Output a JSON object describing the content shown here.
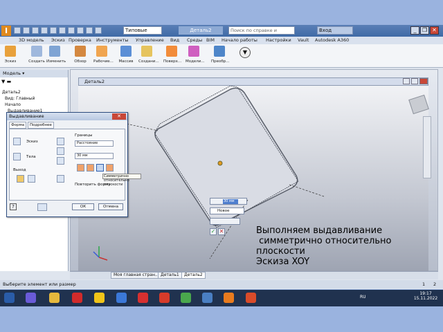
{
  "title_bar": {
    "logo": "I",
    "style_combo": "Типовые",
    "file_name": "Деталь2",
    "help_search": "Поиск по справке и командам",
    "user": "Вход",
    "window_buttons": [
      "_",
      "❐",
      "✕"
    ]
  },
  "menu": [
    "3D модель",
    "Эскиз",
    "Проверка",
    "Инструменты",
    "Управление",
    "Вид",
    "Среды",
    "BIM",
    "Начало работы",
    "Настройки",
    "Vault",
    "Autodesk A360"
  ],
  "ribbon": [
    {
      "label": "Эскиз",
      "color": "#e8a13c"
    },
    {
      "label": "Создать",
      "color": "#9fb8dd"
    },
    {
      "label": "Изменить",
      "color": "#7fa4d4"
    },
    {
      "label": "Обзор",
      "color": "#d48840"
    },
    {
      "label": "Рабочие...",
      "color": "#f0a550"
    },
    {
      "label": "Массив",
      "color": "#5c8fd6"
    },
    {
      "label": "Создани...",
      "color": "#e6c45e"
    },
    {
      "label": "Поверх...",
      "color": "#f28c3a"
    },
    {
      "label": "Модели...",
      "color": "#cf5fc0"
    },
    {
      "label": "Преобр...",
      "color": "#4e86c9"
    }
  ],
  "model_panel": {
    "title": "Модель ▾",
    "tree": [
      "Деталь2",
      "Вид: Главный",
      "Начало",
      "Выдавливание1",
      "",
      "",
      "",
      "",
      "",
      ""
    ]
  },
  "viewport_title": "Деталь2",
  "dialog": {
    "title": "Выдавливание",
    "tabs": [
      "Форма",
      "Подробнее"
    ],
    "profile_label": "Эскиз",
    "solids_label": "Тела",
    "output_label": "Выход",
    "extents_label": "Границы",
    "extents_value": "Расстояние",
    "distance_value": "30 мм",
    "match_shape": "Повторить форму",
    "ok": "ОК",
    "cancel": "Отмена",
    "tooltip": "Симметрично относительно плоскости"
  },
  "minitoolbar": {
    "distance": "30 мм",
    "mode": "Новое"
  },
  "doc_tabs": [
    "Моя главная стран...",
    "Деталь1",
    "Деталь2"
  ],
  "status": {
    "left": "Выберите элемент или размер",
    "right": [
      "1",
      "2"
    ]
  },
  "taskbar": {
    "icons": [
      "#2a5ca8",
      "#6a5bd8",
      "#e6b93d",
      "#d12b2b",
      "#f0c419",
      "#3b78d8",
      "#d63030",
      "#d63b2a",
      "#4aa84d",
      "#4a7fc2",
      "#e87b1e",
      "#d84b2a"
    ],
    "lang": "RU",
    "time": "19:17",
    "date": "15.11.2022"
  },
  "caption": {
    "lines": [
      "Выполняем выдавливание",
      " симметрично относительно",
      "плоскости",
      "Эскиза XOY"
    ]
  }
}
